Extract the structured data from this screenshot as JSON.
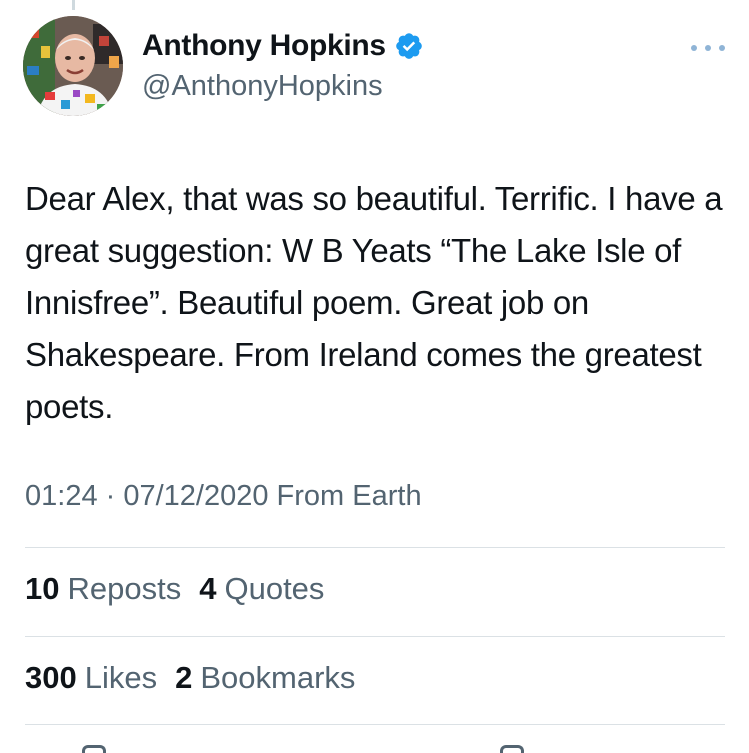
{
  "author": {
    "display_name": "Anthony Hopkins",
    "handle": "@AnthonyHopkins",
    "verified_icon": "verified-badge-icon",
    "verified_color": "#1d9bf0"
  },
  "tweet": {
    "text": "Dear Alex, that was so beautiful. Terrific. I have a great suggestion: W B Yeats “The Lake Isle of Innisfree”. Beautiful poem. Great job on Shakespeare. From Ireland comes the greatest poets.",
    "timestamp": "01:24 · 07/12/2020 From Earth"
  },
  "stats": {
    "reposts_count": "10",
    "reposts_label": "Reposts",
    "quotes_count": "4",
    "quotes_label": "Quotes",
    "likes_count": "300",
    "likes_label": "Likes",
    "bookmarks_count": "2",
    "bookmarks_label": "Bookmarks"
  },
  "icons": {
    "more": "more-options-icon"
  }
}
